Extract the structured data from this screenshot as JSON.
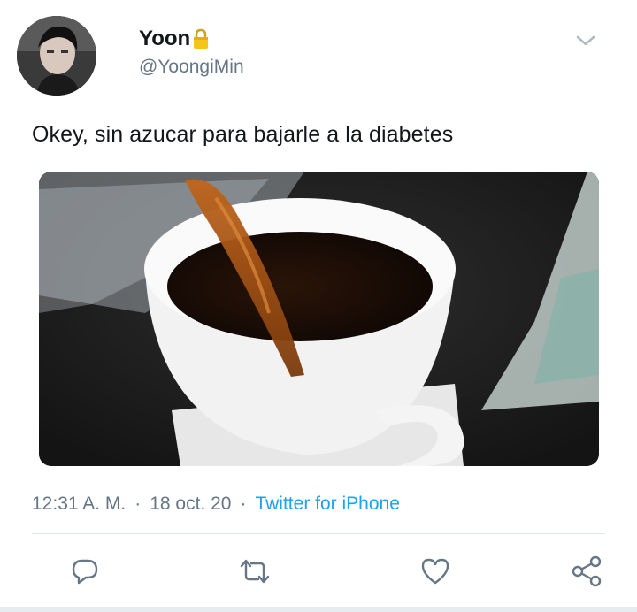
{
  "author": {
    "display_name": "Yoon",
    "handle": "@YoongiMin",
    "avatar_icon": "profile-photo",
    "locked_icon": "lock-icon"
  },
  "tweet": {
    "text": "Okey, sin azucar para bajarle a la diabetes",
    "media_description": "coffee-pour-photo"
  },
  "meta": {
    "time": "12:31 A. M.",
    "separator": "·",
    "date": "18 oct. 20",
    "source": "Twitter for iPhone"
  },
  "actions": {
    "reply_icon": "reply-icon",
    "retweet_icon": "retweet-icon",
    "like_icon": "heart-icon",
    "share_icon": "share-icon"
  },
  "colors": {
    "link": "#1da1f2",
    "secondary_text": "#657786",
    "primary_text": "#14171a",
    "icon": "#657786"
  }
}
